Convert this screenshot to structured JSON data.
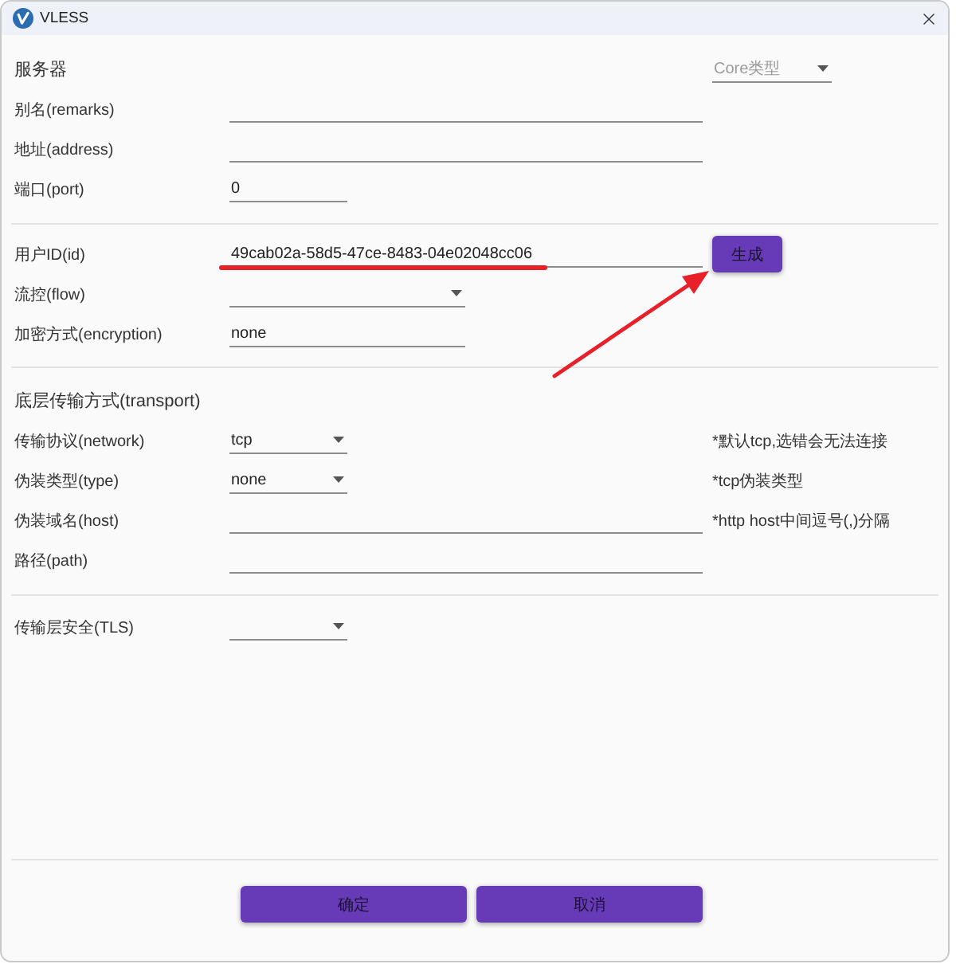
{
  "window": {
    "title": "VLESS"
  },
  "server": {
    "heading": "服务器",
    "core_type": {
      "placeholder": "Core类型"
    },
    "fields": [
      {
        "label": "别名(remarks)",
        "kind": "text"
      },
      {
        "label": "地址(address)",
        "kind": "text"
      },
      {
        "label": "端口(port)",
        "kind": "text",
        "value": "0"
      }
    ]
  },
  "account": {
    "fields": [
      {
        "label": "用户ID(id)",
        "kind": "text",
        "value": "49cab02a-58d5-47ce-8483-04e02048cc06"
      },
      {
        "label": "流控(flow)",
        "kind": "select"
      },
      {
        "label": "加密方式(encryption)",
        "kind": "text",
        "value": "none"
      }
    ],
    "generate_button": "生成"
  },
  "transport": {
    "heading": "底层传输方式(transport)",
    "fields": [
      {
        "label": "传输协议(network)",
        "kind": "select",
        "value": "tcp",
        "hint": "*默认tcp,选错会无法连接"
      },
      {
        "label": "伪装类型(type)",
        "kind": "select",
        "value": "none",
        "hint": "*tcp伪装类型"
      },
      {
        "label": "伪装域名(host)",
        "kind": "text",
        "hint": "*http host中间逗号(,)分隔"
      },
      {
        "label": "路径(path)",
        "kind": "text"
      }
    ]
  },
  "security": {
    "fields": [
      {
        "label": "传输层安全(TLS)",
        "kind": "select"
      }
    ]
  },
  "buttons": [
    "确定",
    "取消"
  ]
}
